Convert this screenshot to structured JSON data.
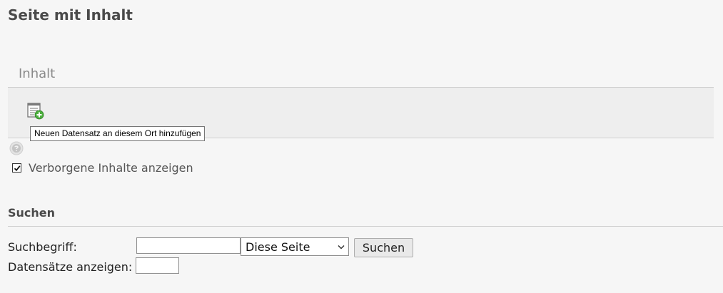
{
  "page": {
    "title": "Seite mit Inhalt"
  },
  "content_section": {
    "title": "Inhalt",
    "add_button_icon": "add-record-icon",
    "tooltip": "Neuen Datensatz an diesem Ort hinzufügen",
    "help_icon": "help-icon"
  },
  "hidden_content": {
    "checked": true,
    "label": "Verborgene Inhalte anzeigen"
  },
  "search": {
    "title": "Suchen",
    "term_label": "Suchbegriff:",
    "term_value": "",
    "scope_selected": "Diese Seite",
    "submit_label": "Suchen",
    "records_label": "Datensätze anzeigen:",
    "records_value": ""
  },
  "colors": {
    "background": "#f6f6f6",
    "panel": "#eeeeee",
    "add_icon_green": "#4caf3d"
  }
}
